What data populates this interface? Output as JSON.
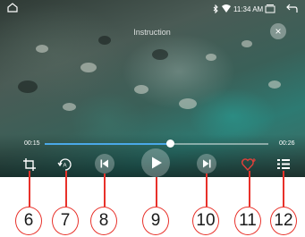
{
  "status_bar": {
    "time": "11:34 AM",
    "icons": [
      "home-icon",
      "bluetooth-icon",
      "wifi-icon",
      "recent-apps-icon",
      "back-icon"
    ]
  },
  "video": {
    "title": "Instruction",
    "elapsed": "00:15",
    "duration": "00:26",
    "progress_fraction": 0.56
  },
  "controls": [
    {
      "name": "crop-icon",
      "callout": "6"
    },
    {
      "name": "repeat-icon",
      "callout": "7"
    },
    {
      "name": "previous-button",
      "callout": "8"
    },
    {
      "name": "play-button",
      "callout": "9"
    },
    {
      "name": "next-button",
      "callout": "10"
    },
    {
      "name": "favorite-button",
      "callout": "11"
    },
    {
      "name": "playlist-button",
      "callout": "12"
    }
  ],
  "colors": {
    "accent": "#4aa8e8",
    "callout_red": "#e8312a",
    "favorite_red": "#e0403a"
  }
}
